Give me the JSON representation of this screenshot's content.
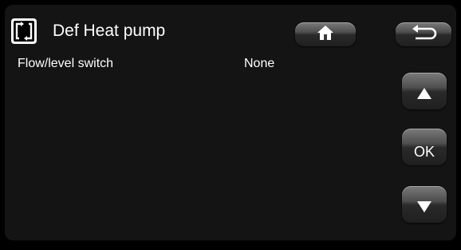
{
  "header": {
    "icon": "swap-arrows-icon",
    "title": "Def Heat pump"
  },
  "toolbar": {
    "home_icon": "home-icon",
    "back_icon": "back-arrow-icon"
  },
  "settings": [
    {
      "label": "Flow/level switch",
      "value": "None"
    }
  ],
  "side_buttons": {
    "up_icon": "arrow-up-icon",
    "ok_label": "OK",
    "down_icon": "arrow-down-icon"
  }
}
